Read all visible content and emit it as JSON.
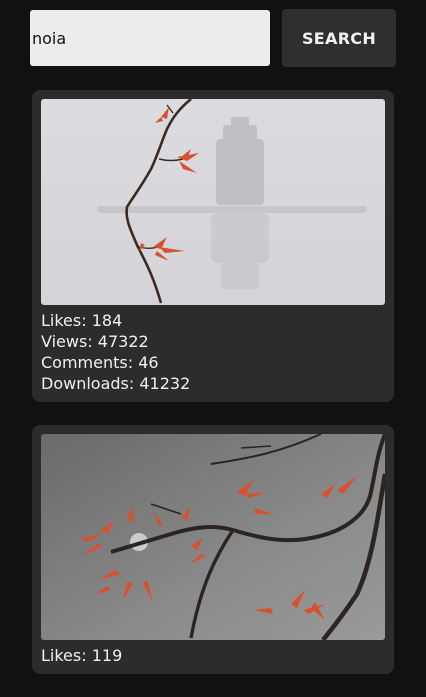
{
  "search": {
    "query": "noia",
    "button_label": "SEARCH"
  },
  "results": [
    {
      "image_alt": "Red leaves on a branch in front of a misty tower on a lake",
      "likes": "Likes: 184",
      "views": "Views: 47322",
      "comments": "Comments: 46",
      "downloads": "Downloads: 41232"
    },
    {
      "image_alt": "Branch with red leaves against a grey misty background",
      "likes": "Likes: 119"
    }
  ],
  "colors": {
    "background": "#111111",
    "card": "#2c2c2c",
    "input": "#ececec",
    "button": "#2f2f2f",
    "text": "#f2f2f2",
    "leaf": "#d9502f"
  }
}
